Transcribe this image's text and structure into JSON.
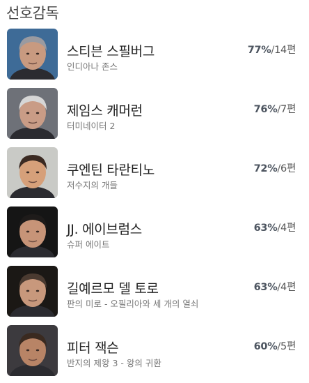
{
  "section_title": "선호감독",
  "directors": [
    {
      "name": "스티븐 스필버그",
      "film": "인디아나 존스",
      "percent": "77%",
      "count": "14",
      "unit": "편",
      "photo": "portrait-photo",
      "skin": "#c89a80",
      "hair": "#9a9aa0",
      "bg": "#3e6b97"
    },
    {
      "name": "제임스 캐머런",
      "film": "터미네이터 2",
      "percent": "76%",
      "count": "7",
      "unit": "편",
      "photo": "portrait-photo",
      "skin": "#c99c86",
      "hair": "#d6d6d6",
      "bg": "#6e7178"
    },
    {
      "name": "쿠엔틴 타란티노",
      "film": "저수지의 개들",
      "percent": "72%",
      "count": "6",
      "unit": "편",
      "photo": "portrait-photo",
      "skin": "#d6a07a",
      "hair": "#3b2a22",
      "bg": "#c9cac6"
    },
    {
      "name": "JJ. 에이브럼스",
      "film": "슈퍼 에이트",
      "percent": "63%",
      "count": "4",
      "unit": "편",
      "photo": "portrait-photo",
      "skin": "#c79478",
      "hair": "#1e1b1a",
      "bg": "#151515"
    },
    {
      "name": "길예르모 델 토로",
      "film": "판의 미로 - 오필리아와 세 개의 열쇠",
      "percent": "63%",
      "count": "4",
      "unit": "편",
      "photo": "portrait-photo",
      "skin": "#c8987c",
      "hair": "#4a3a30",
      "bg": "#1b1815"
    },
    {
      "name": "피터 잭슨",
      "film": "반지의 제왕 3 - 왕의 귀환",
      "percent": "60%",
      "count": "5",
      "unit": "편",
      "photo": "portrait-photo",
      "skin": "#b88466",
      "hair": "#3a2a20",
      "bg": "#3c3a3e"
    }
  ]
}
